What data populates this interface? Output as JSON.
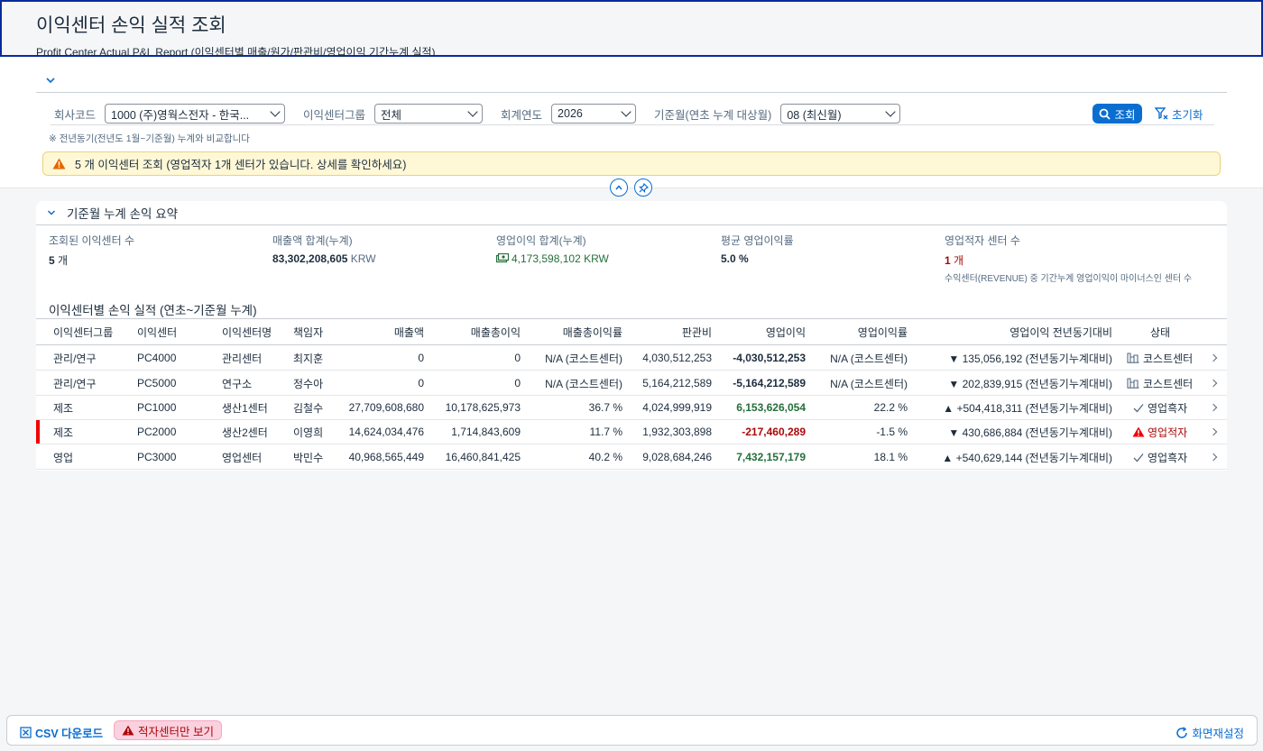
{
  "page": {
    "title": "이익센터 손익 실적 조회",
    "subtitle": "Profit Center Actual P&L Report (이익센터별 매출/원가/판관비/영업이익 기간누계 실적)"
  },
  "filters": {
    "company_label": "회사코드",
    "company_value": "1000 (주)영웍스전자 - 한국...",
    "group_label": "이익센터그룹",
    "group_value": "전체",
    "year_label": "회계연도",
    "year_value": "2026",
    "month_label": "기준월(연초 누계 대상월)",
    "month_value": "08 (최신월)",
    "search_label": "조회",
    "reset_label": "초기화",
    "note": "※ 전년동기(전년도 1월~기준월) 누계와 비교합니다"
  },
  "warning": {
    "text": "5 개 이익센터 조회 (영업적자 1개 센터가 있습니다. 상세를 확인하세요)"
  },
  "summary": {
    "title": "기준월 누계 손익 요약",
    "kpis": [
      {
        "label": "조회된 이익센터 수",
        "value": "5",
        "unit": " 개"
      },
      {
        "label": "매출액 합계(누계)",
        "value": "83,302,208,605",
        "unit": " KRW"
      },
      {
        "label": "영업이익 합계(누계)",
        "value": "4,173,598,102 KRW"
      },
      {
        "label": "평균 영업이익률",
        "value": "5.0 %"
      },
      {
        "label": "영업적자 센터 수",
        "value": "1",
        "unit": " 개",
        "sub": "수익센터(REVENUE) 중 기간누계 영업이익이 마이너스인 센터 수"
      }
    ]
  },
  "table": {
    "title": "이익센터별 손익 실적 (연초~기준월 누계)",
    "headers": [
      "이익센터그룹",
      "이익센터",
      "이익센터명",
      "책임자",
      "매출액",
      "매출총이익",
      "매출총이익률",
      "판관비",
      "영업이익",
      "영업이익률",
      "영업이익 전년동기대비",
      "상태"
    ],
    "rows": [
      {
        "group": "관리/연구",
        "pc": "PC4000",
        "name": "관리센터",
        "owner": "최지훈",
        "sales": "0",
        "gross": "0",
        "gross_rate": "N/A (코스트센터)",
        "sga": "4,030,512,253",
        "op": "-4,030,512,253",
        "op_rate": "N/A (코스트센터)",
        "yoy": "▼ 135,056,192 (전년동기누계대비)",
        "status": "코스트센터"
      },
      {
        "group": "관리/연구",
        "pc": "PC5000",
        "name": "연구소",
        "owner": "정수아",
        "sales": "0",
        "gross": "0",
        "gross_rate": "N/A (코스트센터)",
        "sga": "5,164,212,589",
        "op": "-5,164,212,589",
        "op_rate": "N/A (코스트센터)",
        "yoy": "▼ 202,839,915 (전년동기누계대비)",
        "status": "코스트센터"
      },
      {
        "group": "제조",
        "pc": "PC1000",
        "name": "생산1센터",
        "owner": "김철수",
        "sales": "27,709,608,680",
        "gross": "10,178,625,973",
        "gross_rate": "36.7 %",
        "sga": "4,024,999,919",
        "op": "6,153,626,054",
        "op_rate": "22.2 %",
        "yoy": "▲ +504,418,311 (전년동기누계대비)",
        "status": "영업흑자"
      },
      {
        "group": "제조",
        "pc": "PC2000",
        "name": "생산2센터",
        "owner": "이영희",
        "sales": "14,624,034,476",
        "gross": "1,714,843,609",
        "gross_rate": "11.7 %",
        "sga": "1,932,303,898",
        "op": "-217,460,289",
        "op_rate": "-1.5 %",
        "yoy": "▼ 430,686,884 (전년동기누계대비)",
        "status": "영업적자"
      },
      {
        "group": "영업",
        "pc": "PC3000",
        "name": "영업센터",
        "owner": "박민수",
        "sales": "40,968,565,449",
        "gross": "16,460,841,425",
        "gross_rate": "40.2 %",
        "sga": "9,028,684,246",
        "op": "7,432,157,179",
        "op_rate": "18.1 %",
        "yoy": "▲ +540,629,144 (전년동기누계대비)",
        "status": "영업흑자"
      }
    ]
  },
  "footer": {
    "csv_label": "CSV 다운로드",
    "loss_only_label": "적자센터만 보기",
    "reload_label": "화면재설정"
  },
  "colors": {
    "accent": "#0a6ed1",
    "negative": "#aa0808",
    "positive": "#256f3a",
    "warning_bg": "#fff8d6"
  }
}
